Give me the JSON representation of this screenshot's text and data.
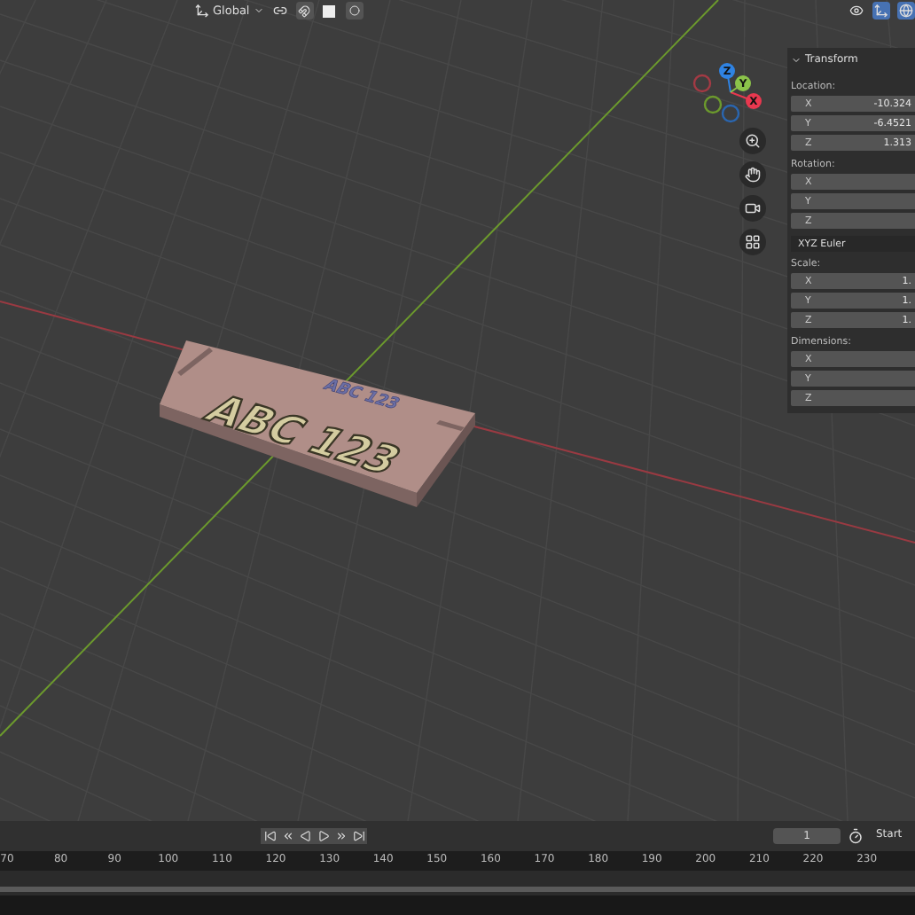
{
  "header": {
    "orientation": "Global"
  },
  "gizmo": {
    "axes": [
      {
        "label": "Z",
        "color": "#2f83e3"
      },
      {
        "label": "Y",
        "color": "#8bc34a"
      },
      {
        "label": "X",
        "color": "#e8384f"
      }
    ]
  },
  "viewport": {
    "plate_texts": [
      "ABC 123",
      "ABC 123"
    ]
  },
  "transform": {
    "title": "Transform",
    "expanded": true,
    "sections": [
      {
        "label": "Location:",
        "fields": [
          {
            "axis": "X",
            "value": "-10.324"
          },
          {
            "axis": "Y",
            "value": "-6.4521"
          },
          {
            "axis": "Z",
            "value": "1.313"
          }
        ]
      },
      {
        "label": "Rotation:",
        "fields": [
          {
            "axis": "X"
          },
          {
            "axis": "Y"
          },
          {
            "axis": "Z"
          }
        ],
        "dropdown": "XYZ Euler"
      },
      {
        "label": "Scale:",
        "fields": [
          {
            "axis": "X",
            "value": "1."
          },
          {
            "axis": "Y",
            "value": "1."
          },
          {
            "axis": "Z",
            "value": "1."
          }
        ]
      },
      {
        "label": "Dimensions:",
        "fields": [
          {
            "axis": "X"
          },
          {
            "axis": "Y"
          },
          {
            "axis": "Z"
          }
        ]
      }
    ]
  },
  "timeline": {
    "frame": "1",
    "start_label": "Start",
    "ruler": [
      "70",
      "80",
      "90",
      "100",
      "110",
      "120",
      "130",
      "140",
      "150",
      "160",
      "170",
      "180",
      "190",
      "200",
      "210",
      "220",
      "230"
    ]
  }
}
